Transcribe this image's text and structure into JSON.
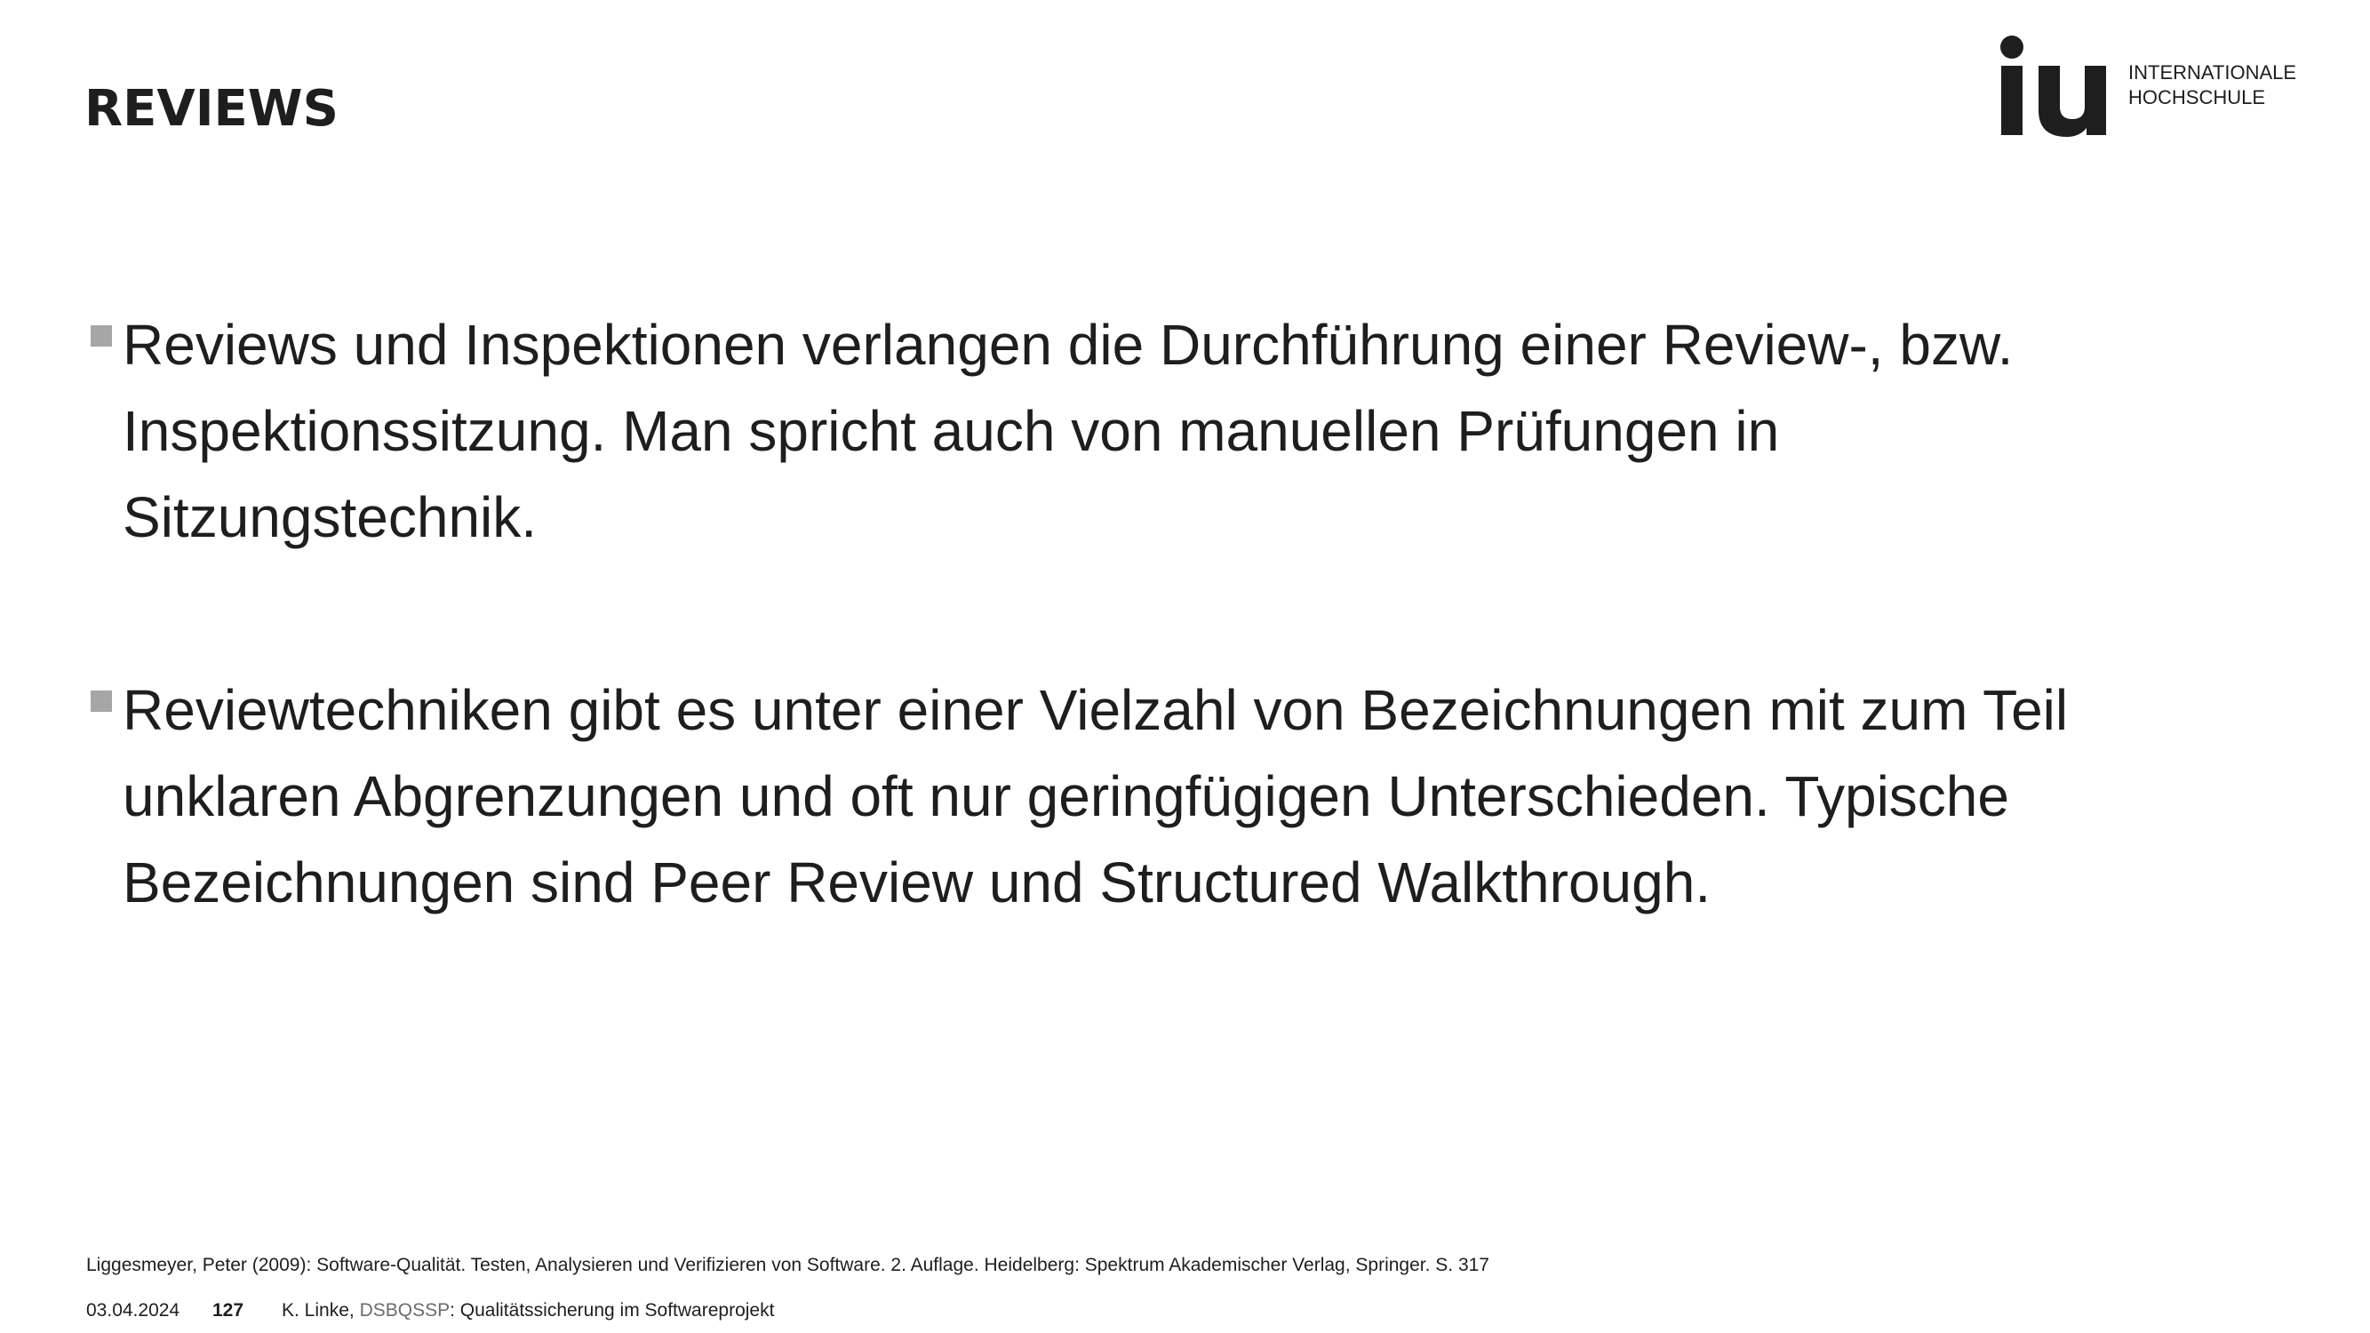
{
  "header": {
    "title": "REVIEWS"
  },
  "logo": {
    "mark": "iu",
    "line1": "INTERNATIONALE",
    "line2": "HOCHSCHULE"
  },
  "content": {
    "bullets": [
      {
        "lines": [
          "Reviews und Inspektionen verlangen die Durchführung einer Review-, bzw.",
          "Inspektionssitzung. Man spricht auch von manuellen Prüfungen in",
          "Sitzungstechnik."
        ]
      },
      {
        "lines": [
          "Reviewtechniken gibt es unter einer Vielzahl von Bezeichnungen mit zum Teil",
          "unklaren Abgrenzungen und oft nur geringfügigen Unterschieden. Typische",
          "Bezeichnungen sind Peer Review und Structured Walkthrough."
        ]
      }
    ],
    "bullet_color": "#a6a6a6"
  },
  "reference": "Liggesmeyer, Peter (2009): Software-Qualität. Testen, Analysieren und Verifizieren von Software. 2. Auflage. Heidelberg: Spektrum Akademischer Verlag, Springer. S. 317",
  "footer": {
    "date": "03.04.2024",
    "page": "127",
    "author": "K. Linke, ",
    "course_code": "DSBQSSP",
    "course_title": ": Qualitätssicherung im Softwareprojekt"
  }
}
